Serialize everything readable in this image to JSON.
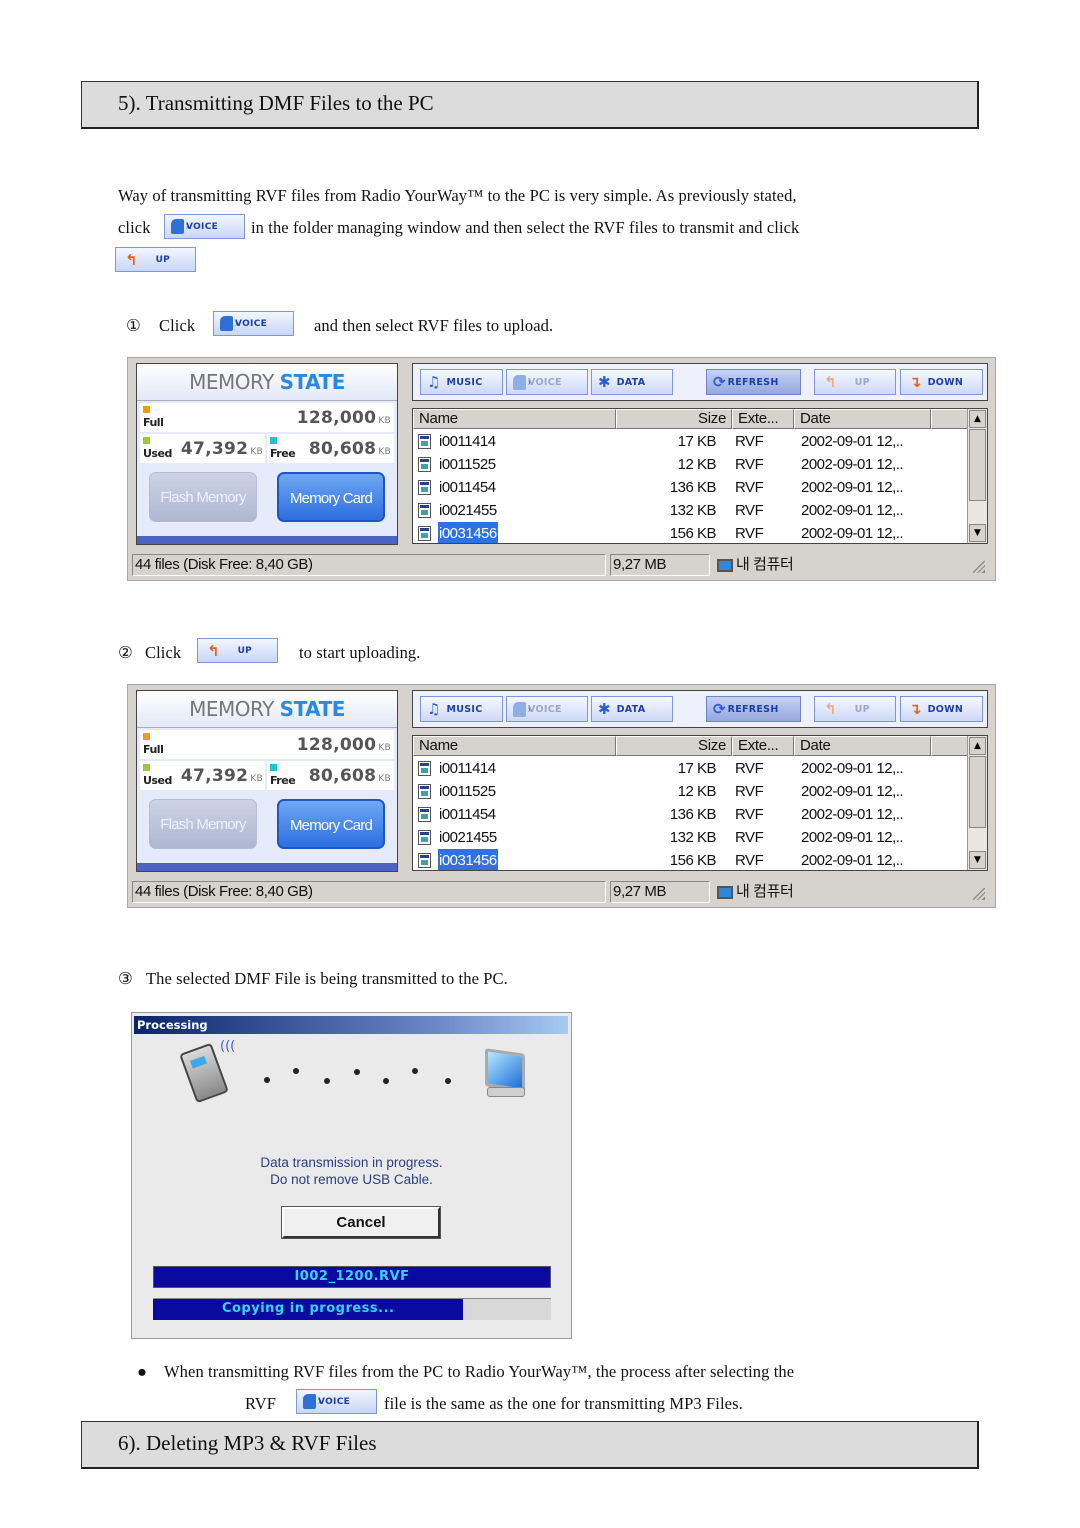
{
  "section5": {
    "title": "5). Transmitting DMF Files to the PC",
    "intro_line1": "Way of transmitting RVF files from Radio YourWay™ to the PC is very simple. As previously stated,",
    "intro_line2_pre": "click",
    "intro_line2_post": "in the folder managing window and then select the RVF files to transmit and click",
    "step1": {
      "num": "①",
      "pre": "Click",
      "post": "and then select RVF files to upload."
    },
    "step2": {
      "num": "②",
      "pre": "Click",
      "post": "to start uploading."
    },
    "step3": {
      "num": "③",
      "text": "The selected DMF File is being transmitted to the PC."
    },
    "note_bullet": "●",
    "note_line1": "When transmitting RVF files from the PC to Radio YourWay™, the process after selecting the",
    "note_line2_pre": "RVF",
    "note_line2_post": "file is the same as the one for transmitting MP3 Files."
  },
  "section6": {
    "title": "6). Deleting MP3 & RVF Files"
  },
  "buttons": {
    "voice": "VOICE",
    "up": "UP"
  },
  "app": {
    "memory_state": {
      "title_part1": "MEMORY",
      "title_part2": "STATE",
      "full_label": "Full",
      "full_value": "128,000",
      "used_label": "Used",
      "used_value": "47,392",
      "free_label": "Free",
      "free_value": "80,608",
      "unit": "KB",
      "flash_memory_label": "Flash Memory",
      "memory_card_label": "Memory Card",
      "swatch_colors": {
        "full": "#f39a1e",
        "used": "#9bc83a",
        "free": "#1fc4d0"
      }
    },
    "toolbar": {
      "music": "MUSIC",
      "voice": "VOICE",
      "data": "DATA",
      "refresh": "REFRESH",
      "up": "UP",
      "down": "DOWN"
    },
    "columns": [
      "Name",
      "Size",
      "Exte...",
      "Date"
    ],
    "files": [
      {
        "name": "i0011414",
        "size": "17 KB",
        "ext": "RVF",
        "date": "2002-09-01 12,.."
      },
      {
        "name": "i0011525",
        "size": "12 KB",
        "ext": "RVF",
        "date": "2002-09-01 12,.."
      },
      {
        "name": "i0011454",
        "size": "136 KB",
        "ext": "RVF",
        "date": "2002-09-01 12,.."
      },
      {
        "name": "i0021455",
        "size": "132 KB",
        "ext": "RVF",
        "date": "2002-09-01 12,.."
      },
      {
        "name": "i0031456",
        "size": "156 KB",
        "ext": "RVF",
        "date": "2002-09-01 12,..",
        "selected": true
      }
    ],
    "status": {
      "files": "44 files (Disk Free: 8,40 GB)",
      "size": "9,27 MB",
      "location": "내 컴퓨터"
    }
  },
  "processing": {
    "title": "Processing",
    "message_line1": "Data transmission in progress.",
    "message_line2": "Do not remove USB Cable.",
    "cancel": "Cancel",
    "filename": "I002_1200.RVF",
    "progress_text": "Copying in progress...",
    "progress_fraction": 0.78
  }
}
